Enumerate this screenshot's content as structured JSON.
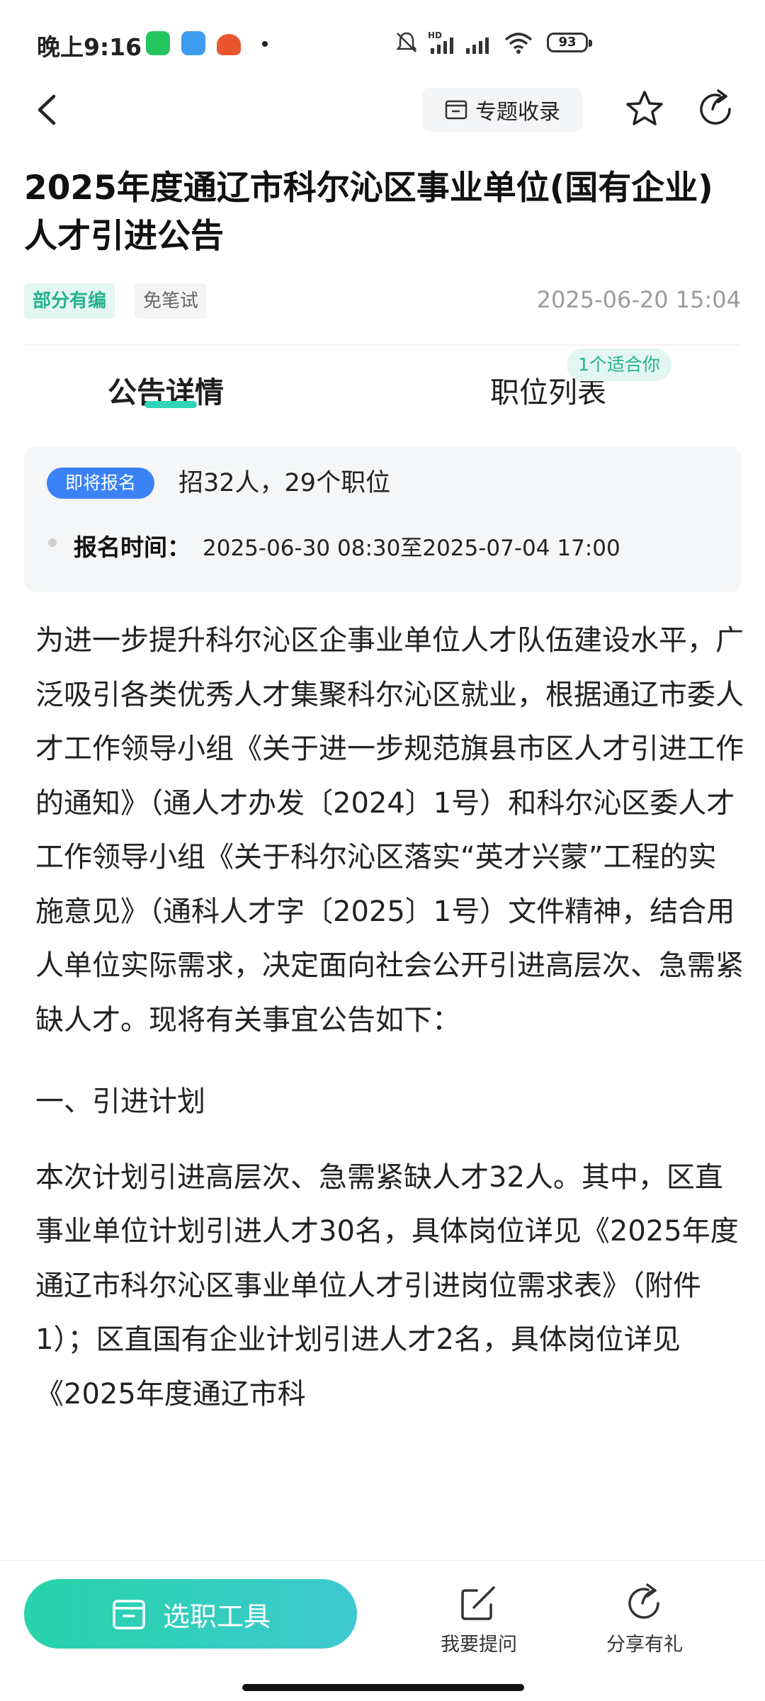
{
  "status_bar": {
    "time": "晚上9:16",
    "battery": "93"
  },
  "header": {
    "topic_collect_label": "专题收录"
  },
  "title": "2025年度通辽市科尔沁区事业单位(国有企业)人才引进公告",
  "tags": [
    "部分有编",
    "免笔试"
  ],
  "published_at": "2025-06-20 15:04",
  "tabs": [
    {
      "label": "公告详情",
      "active": true
    },
    {
      "label": "职位列表",
      "active": false,
      "badge": "1个适合你"
    }
  ],
  "info_card": {
    "status_pill": "即将报名",
    "recruit_summary": "招32人，29个职位",
    "registration_label": "报名时间：",
    "registration_value": "2025-06-30 08:30至2025-07-04 17:00"
  },
  "content": {
    "paragraph_1": "为进一步提升科尔沁区企事业单位人才队伍建设水平，广泛吸引各类优秀人才集聚科尔沁区就业，根据通辽市委人才工作领导小组《关于进一步规范旗县市区人才引进工作的通知》（通人才办发〔2024〕1号）和科尔沁区委人才工作领导小组《关于科尔沁区落实“英才兴蒙”工程的实施意见》（通科人才字〔2025〕1号）文件精神，结合用人单位实际需求，决定面向社会公开引进高层次、急需紧缺人才。现将有关事宜公告如下：",
    "section_1_title": "一、引进计划",
    "paragraph_2": "本次计划引进高层次、急需紧缺人才32人。其中，区直事业单位计划引进人才30名，具体岗位详见《2025年度通辽市科尔沁区事业单位人才引进岗位需求表》（附件1）；区直国有企业计划引进人才2名，具体岗位详见《2025年度通辽市科"
  },
  "bottom_bar": {
    "tool_button_label": "选职工具",
    "ask_label": "我要提问",
    "share_label": "分享有礼"
  },
  "colors": {
    "accent_green": "#26b28e",
    "button_gradient_start": "#26d3a9",
    "button_gradient_end": "#3dc9d0",
    "pill_blue": "#3a82f6"
  }
}
